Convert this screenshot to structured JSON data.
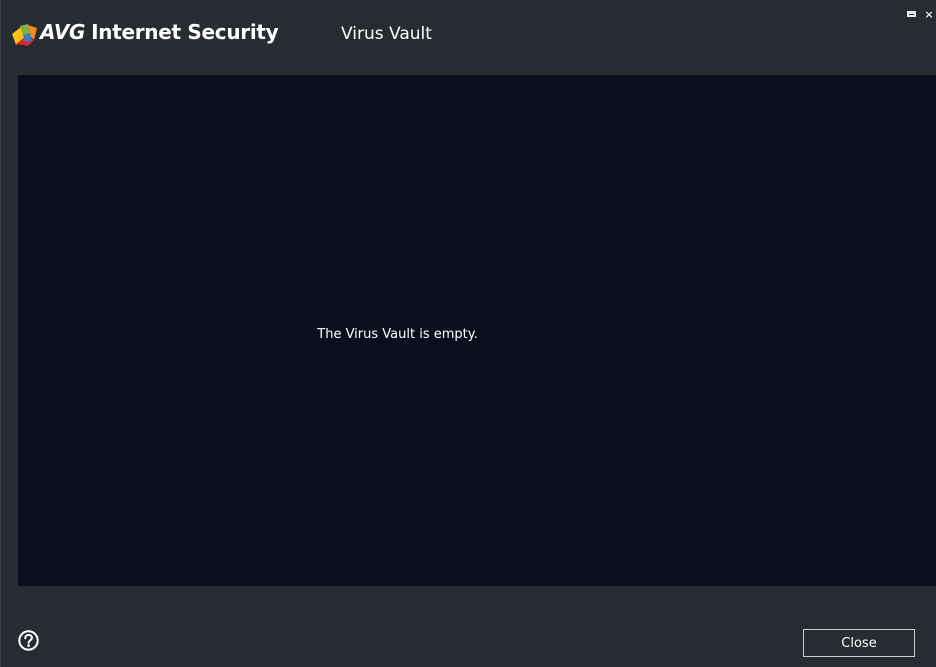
{
  "app": {
    "brand_prefix": "AVG",
    "brand_product": "Internet Security",
    "section_title": "Virus Vault"
  },
  "window_controls": {
    "restore_icon": "restore-icon",
    "close_glyph": "×"
  },
  "content": {
    "empty_message": "The Virus Vault is empty."
  },
  "footer": {
    "help_icon": "help-icon",
    "close_label": "Close"
  },
  "colors": {
    "title_background": "#272b32",
    "content_background": "#0b0f1d",
    "logo_green": "#7bb53b",
    "logo_orange": "#f08a1c",
    "logo_red": "#d8262e",
    "logo_yellow": "#f8c21b"
  }
}
